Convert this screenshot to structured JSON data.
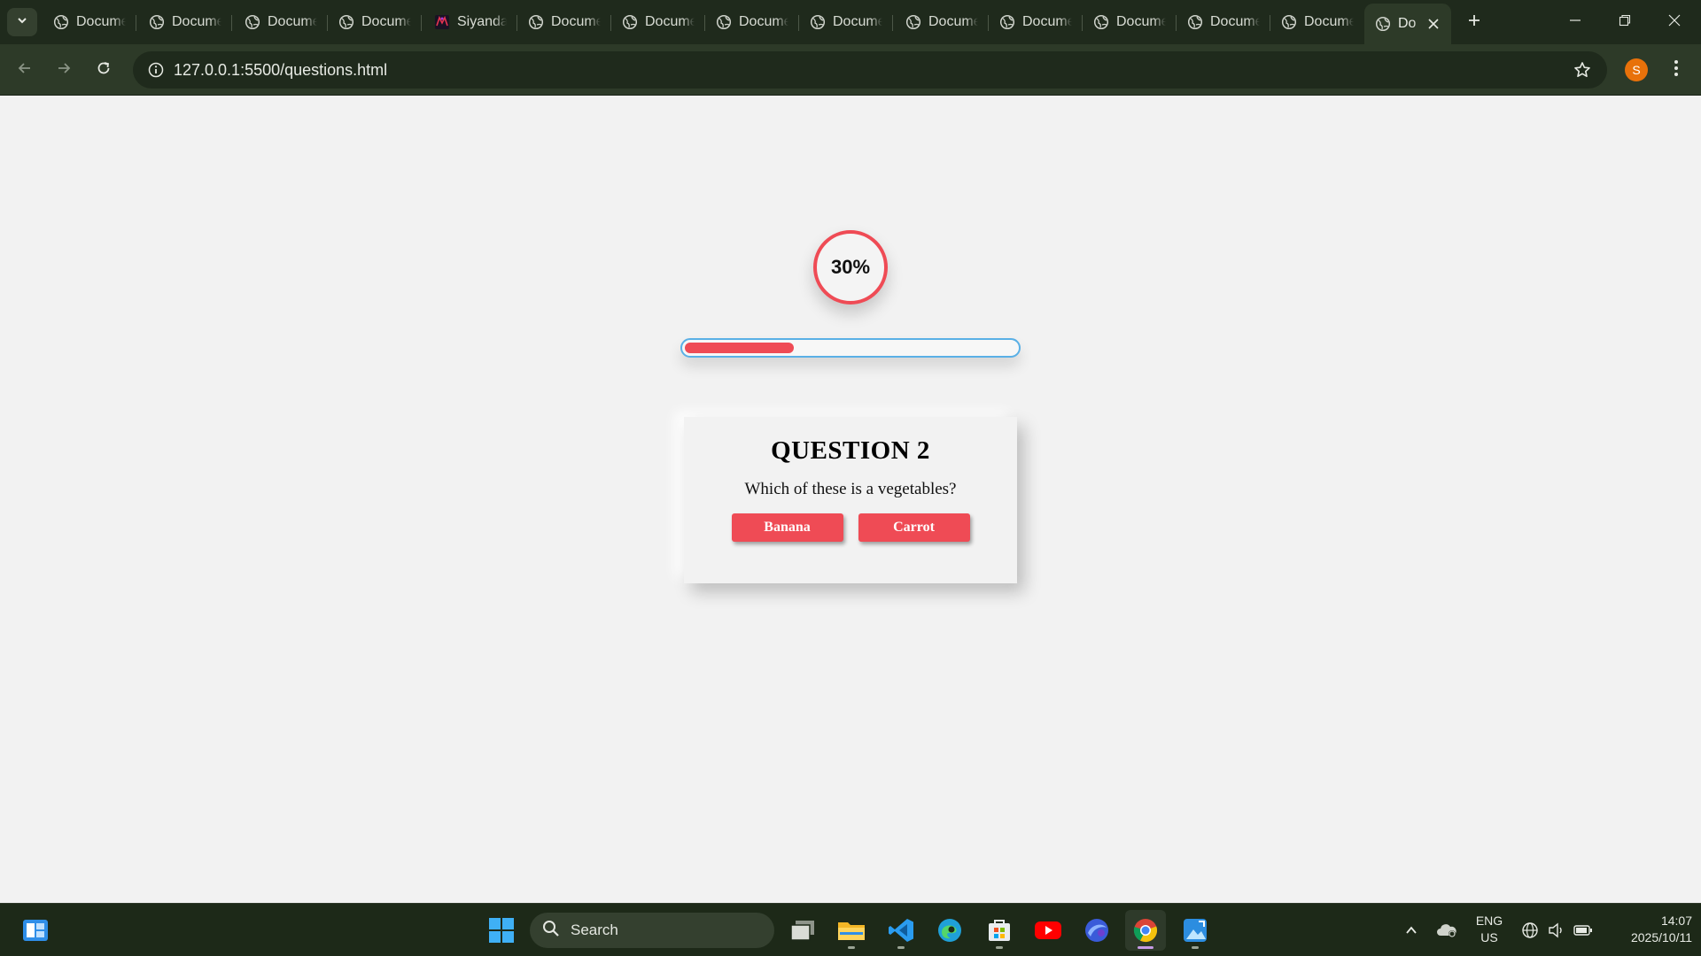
{
  "browser": {
    "tabs": [
      {
        "title": "Document",
        "icon": "globe-icon"
      },
      {
        "title": "Document",
        "icon": "globe-icon"
      },
      {
        "title": "Document",
        "icon": "globe-icon"
      },
      {
        "title": "Document",
        "icon": "globe-icon"
      },
      {
        "title": "Siyanda",
        "icon": "app-favicon-icon"
      },
      {
        "title": "Document",
        "icon": "globe-icon"
      },
      {
        "title": "Document",
        "icon": "globe-icon"
      },
      {
        "title": "Document",
        "icon": "globe-icon"
      },
      {
        "title": "Document",
        "icon": "globe-icon"
      },
      {
        "title": "Document",
        "icon": "globe-icon"
      },
      {
        "title": "Document",
        "icon": "globe-icon"
      },
      {
        "title": "Document",
        "icon": "globe-icon"
      },
      {
        "title": "Document",
        "icon": "globe-icon"
      },
      {
        "title": "Document",
        "icon": "globe-icon"
      },
      {
        "title": "Do",
        "icon": "globe-icon",
        "active": true
      }
    ],
    "url": "127.0.0.1:5500/questions.html",
    "profile_initial": "S"
  },
  "quiz": {
    "progress_label": "30%",
    "progress_fraction": 0.33,
    "question_title": "QUESTION 2",
    "question_text": "Which of these is a vegetables?",
    "answers": [
      "Banana",
      "Carrot"
    ]
  },
  "taskbar": {
    "search_label": "Search",
    "language": {
      "line1": "ENG",
      "line2": "US"
    },
    "clock": {
      "time": "14:07",
      "date": "2025/10/11"
    }
  },
  "colors": {
    "accent": "#ef4b55",
    "progress_border": "#5ab0e6",
    "chrome_dark": "#1f2a1c",
    "chrome_toolbar": "#2d3a28",
    "profile": "#e8710a"
  }
}
